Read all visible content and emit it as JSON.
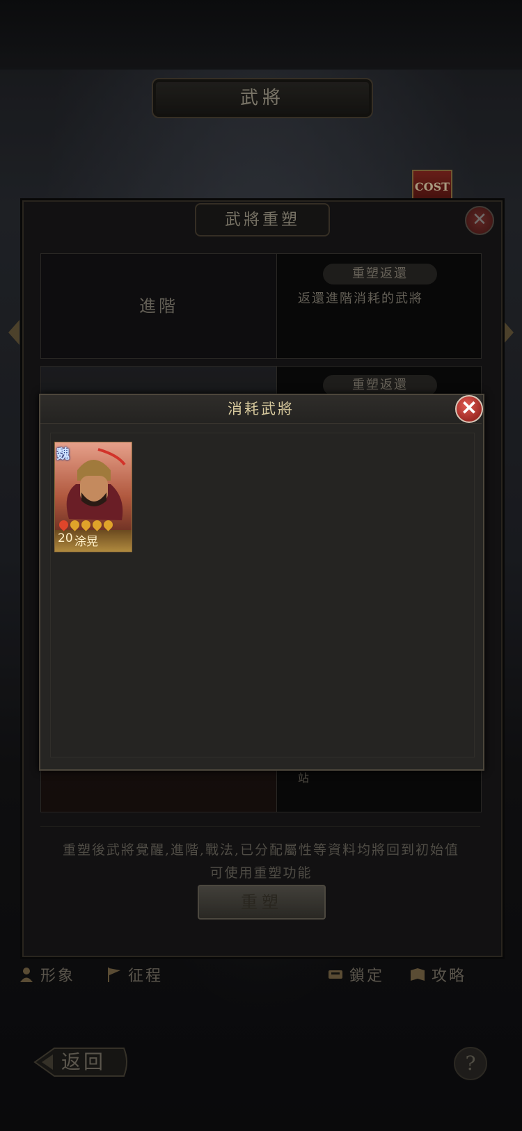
{
  "screen": {
    "title": "武將"
  },
  "cost_badge": "COST",
  "reshape_panel": {
    "title": "武將重塑",
    "row1": {
      "left_label": "進階",
      "pill_label": "重塑返還",
      "description": "返還進階消耗的武將"
    },
    "row2": {
      "pill_label": "重塑返還",
      "fragment": "站"
    },
    "notice_line1": "重塑後武將覺醒,進階,戰法,已分配屬性等資料均將回到初始值",
    "notice_line2": "可使用重塑功能",
    "button_label": "重塑"
  },
  "bottom_bar": {
    "items": [
      {
        "label": "形象",
        "icon": "figure-icon"
      },
      {
        "label": "征程",
        "icon": "flag-icon"
      },
      {
        "label": "鎖定",
        "icon": "lock-icon"
      },
      {
        "label": "攻略",
        "icon": "guide-icon"
      }
    ],
    "back_label": "返回",
    "help_label": "?"
  },
  "dialog": {
    "title": "消耗武將",
    "close_label": "✕",
    "heroes": [
      {
        "faction": "魏",
        "level": "20",
        "name": "涂晃",
        "stars_total": 5,
        "stars_red": 1
      }
    ]
  },
  "colors": {
    "accent_gold": "#d8ca9e",
    "close_red": "#c4463f",
    "card_frame": "#8a6a3a"
  }
}
